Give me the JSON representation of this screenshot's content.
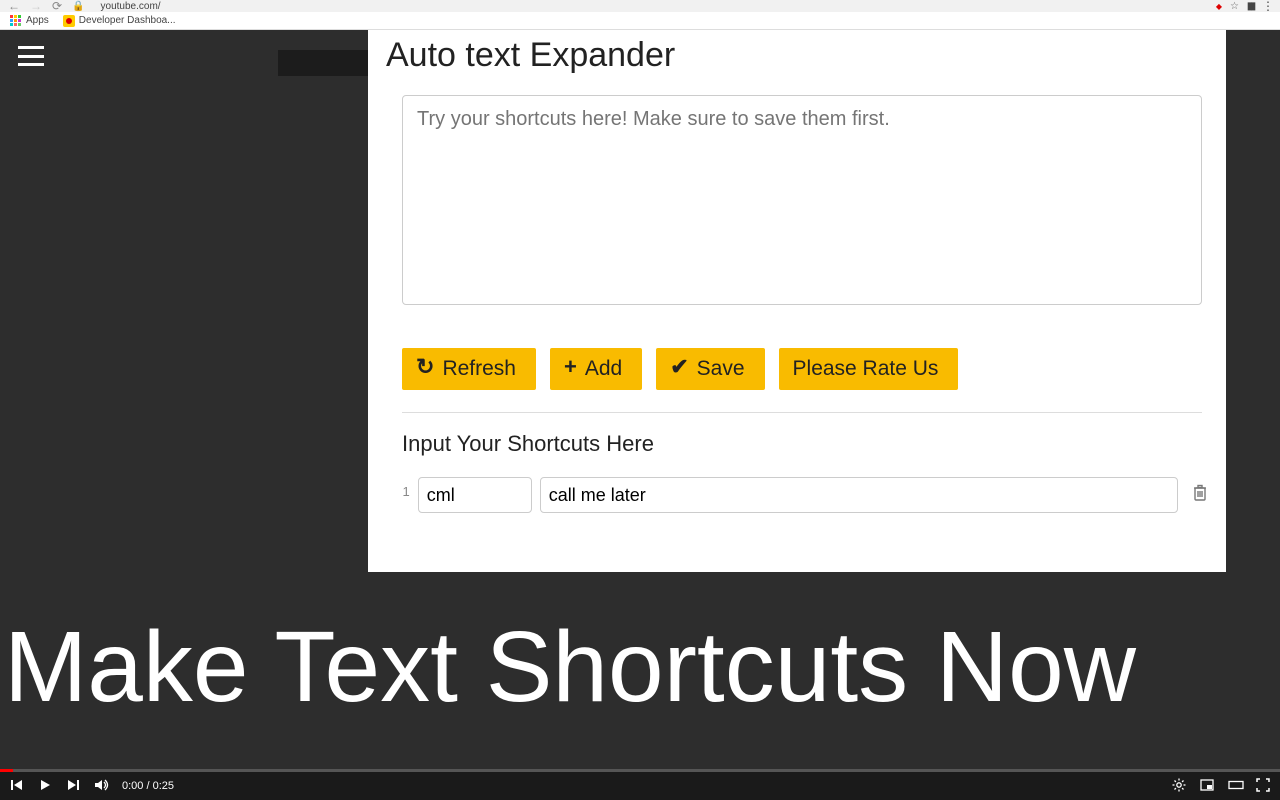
{
  "browser": {
    "url": "youtube.com/",
    "apps_label": "Apps",
    "bookmark1": "Developer Dashboa..."
  },
  "popup": {
    "title": "Auto text Expander",
    "try_placeholder": "Try your shortcuts here! Make sure to save them first.",
    "buttons": {
      "refresh": "Refresh",
      "add": "Add",
      "save": "Save",
      "rate": "Please Rate Us"
    },
    "subheading": "Input Your Shortcuts Here",
    "rows": [
      {
        "num": "1",
        "short": "cml",
        "expand": "call me later"
      }
    ]
  },
  "promo": "Make Text Shortcuts Now",
  "player": {
    "time": "0:00 / 0:25"
  }
}
